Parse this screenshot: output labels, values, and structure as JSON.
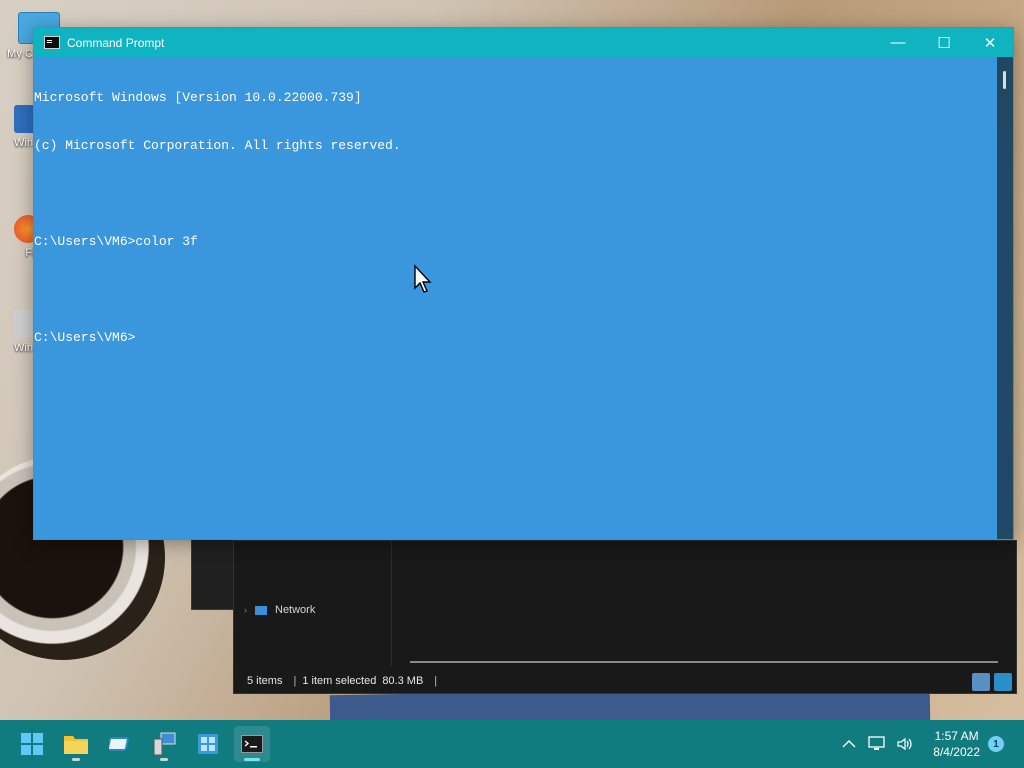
{
  "desktop": {
    "icons": [
      {
        "label": "My C",
        "icon": "computer-icon"
      },
      {
        "label": "Win San",
        "icon": "sandbox-icon"
      },
      {
        "label": "Fi",
        "icon": "firefox-icon"
      },
      {
        "label": "Win To",
        "icon": "tool-icon"
      }
    ]
  },
  "explorer": {
    "nav_network": "Network",
    "status_items": "5 items",
    "status_selected": "1 item selected",
    "status_size": "80.3 MB"
  },
  "cmd": {
    "title": "Command Prompt",
    "lines": [
      "Microsoft Windows [Version 10.0.22000.739]",
      "(c) Microsoft Corporation. All rights reserved.",
      "",
      "C:\\Users\\VM6>color 3f",
      "",
      "C:\\Users\\VM6>"
    ],
    "controls": {
      "minimize": "—",
      "maximize": "☐",
      "close": "✕"
    },
    "colors": {
      "background": "#3a96dd",
      "titlebar": "#10b4c0",
      "text": "#ffffff"
    }
  },
  "taskbar": {
    "apps": [
      {
        "name": "start-icon",
        "active": false
      },
      {
        "name": "file-explorer-icon",
        "active": false
      },
      {
        "name": "sandbox-app-icon",
        "active": false
      },
      {
        "name": "remote-desktop-icon",
        "active": false
      },
      {
        "name": "windows-tools-icon",
        "active": false
      },
      {
        "name": "terminal-icon",
        "active": true
      }
    ],
    "time": "1:57 AM",
    "date": "8/4/2022",
    "notifications": "1",
    "color": "#117c80"
  }
}
